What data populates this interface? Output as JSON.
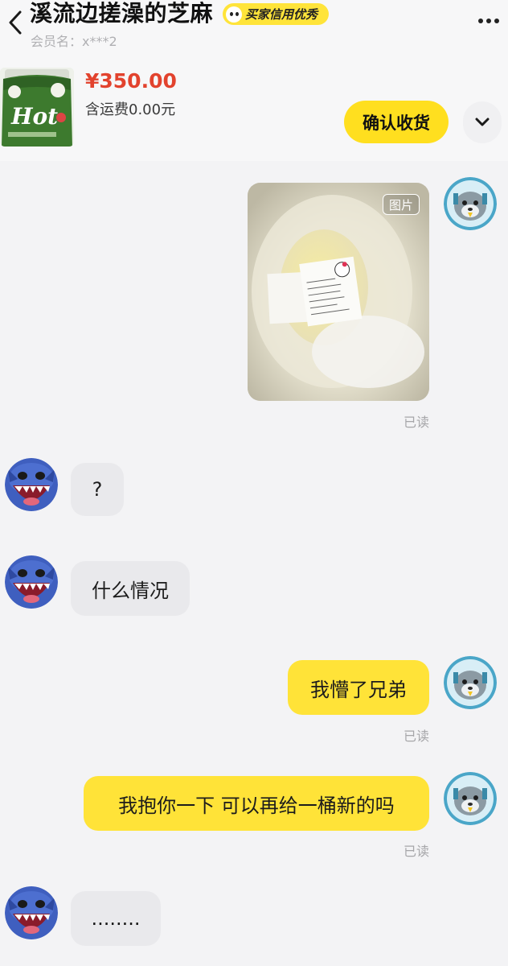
{
  "header": {
    "title": "溪流边搓澡的芝麻",
    "credit_badge": "买家信用优秀",
    "member_label": "会员名：x***2"
  },
  "product": {
    "thumb_text": "Hot",
    "price": "¥350.00",
    "shipping": "含运费0.00元",
    "confirm_label": "确认收货"
  },
  "messages": [
    {
      "side": "out",
      "type": "image",
      "tag": "图片",
      "read": "已读"
    },
    {
      "side": "in",
      "text": "?"
    },
    {
      "side": "in",
      "text": "什么情况"
    },
    {
      "side": "out",
      "text": "我懵了兄弟",
      "read": "已读"
    },
    {
      "side": "out",
      "text": "我抱你一下 可以再给一桶新的吗",
      "read": "已读"
    },
    {
      "side": "in",
      "text": "........"
    }
  ],
  "colors": {
    "accent_yellow": "#ffe338",
    "price_red": "#e2432e",
    "incoming_bubble": "#e9e9ec"
  },
  "icons": {
    "back": "chevron-left-icon",
    "more": "more-dots-icon",
    "expand": "chevron-down-icon"
  }
}
